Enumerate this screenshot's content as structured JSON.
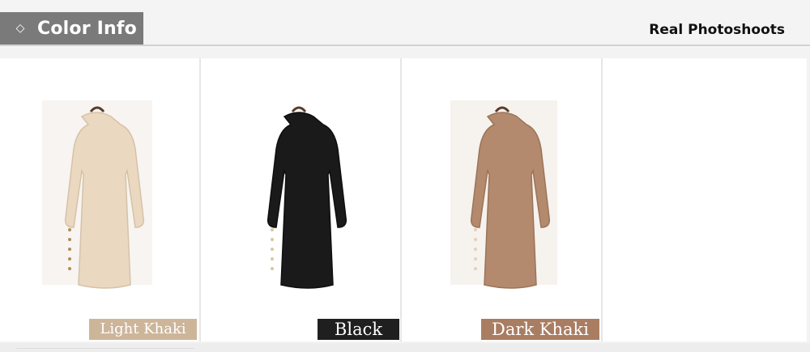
{
  "header": {
    "tab_label": "Color Info",
    "tab_icon": "diamond-icon",
    "tagline": "Real Photoshoots"
  },
  "colors": {
    "tab_bg": "#7a7a7a",
    "light_khaki": "#ead8c0",
    "black": "#1c1c1c",
    "dark_khaki": "#b38a6d"
  },
  "variants": [
    {
      "label": "Light Khaki",
      "label_bg": "#cdb59a",
      "dress_color": "#ead8c0"
    },
    {
      "label": "Black",
      "label_bg": "#1f1f1f",
      "dress_color": "#1a1a1a"
    },
    {
      "label": "Dark Khaki",
      "label_bg": "#a97d62",
      "dress_color": "#b38a6d"
    },
    {
      "label": "",
      "label_bg": "",
      "dress_color": ""
    }
  ]
}
